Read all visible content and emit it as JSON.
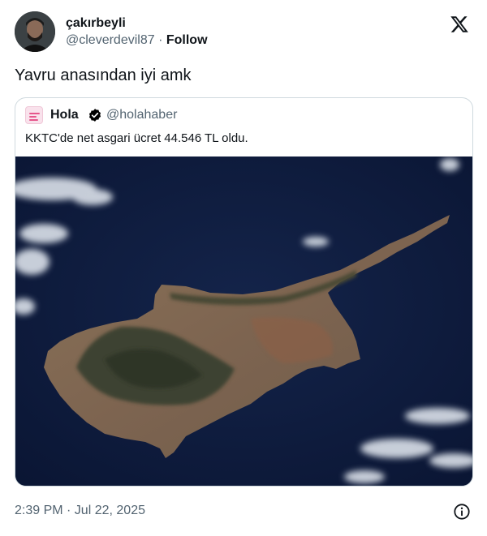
{
  "author": {
    "display_name": "çakırbeyli",
    "handle": "@cleverdevil87",
    "separator": "·",
    "follow_label": "Follow",
    "avatar_icon": "profile-photo"
  },
  "tweet": {
    "text": "Yavru anasından iyi amk",
    "timestamp": "2:39 PM · Jul 22, 2025"
  },
  "quoted": {
    "display_name": "Hola",
    "handle": "@holahaber",
    "text": "KKTC'de net asgari ücret 44.546 TL oldu.",
    "avatar_icon": "hola-logo",
    "verified_icon": "verified-badge-icon",
    "media_icon": "satellite-image-of-cyprus"
  },
  "icons": {
    "brand": "x-logo-icon",
    "info": "info-icon"
  },
  "colors": {
    "text_primary": "#0f1419",
    "text_secondary": "#536471",
    "border": "#cfd9de",
    "sea": "#0d1a3a",
    "verified": "#000000"
  }
}
